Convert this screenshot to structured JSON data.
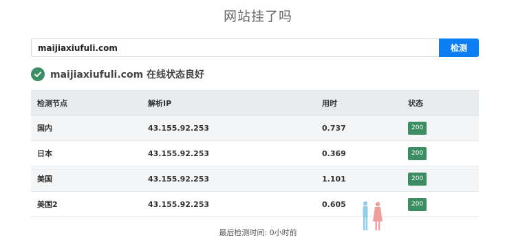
{
  "header": {
    "title": "网站挂了吗"
  },
  "search": {
    "value": "maijiaxiufuli.com",
    "button_label": "检测"
  },
  "status": {
    "text": "maijiaxiufuli.com 在线状态良好"
  },
  "table": {
    "columns": [
      "检测节点",
      "解析IP",
      "用时",
      "状态"
    ],
    "rows": [
      {
        "node": "国内",
        "ip": "43.155.92.253",
        "time": "0.737",
        "code": "200"
      },
      {
        "node": "日本",
        "ip": "43.155.92.253",
        "time": "0.369",
        "code": "200"
      },
      {
        "node": "美国",
        "ip": "43.155.92.253",
        "time": "1.101",
        "code": "200"
      },
      {
        "node": "美国2",
        "ip": "43.155.92.253",
        "time": "0.605",
        "code": "200"
      }
    ]
  },
  "footer": {
    "text": "最后检测时间: 0小时前"
  },
  "colors": {
    "accent": "#0d7ef2",
    "success": "#3d8d62"
  },
  "icons": {
    "status": "check-circle-icon",
    "watermark": "people-figures-icon"
  }
}
